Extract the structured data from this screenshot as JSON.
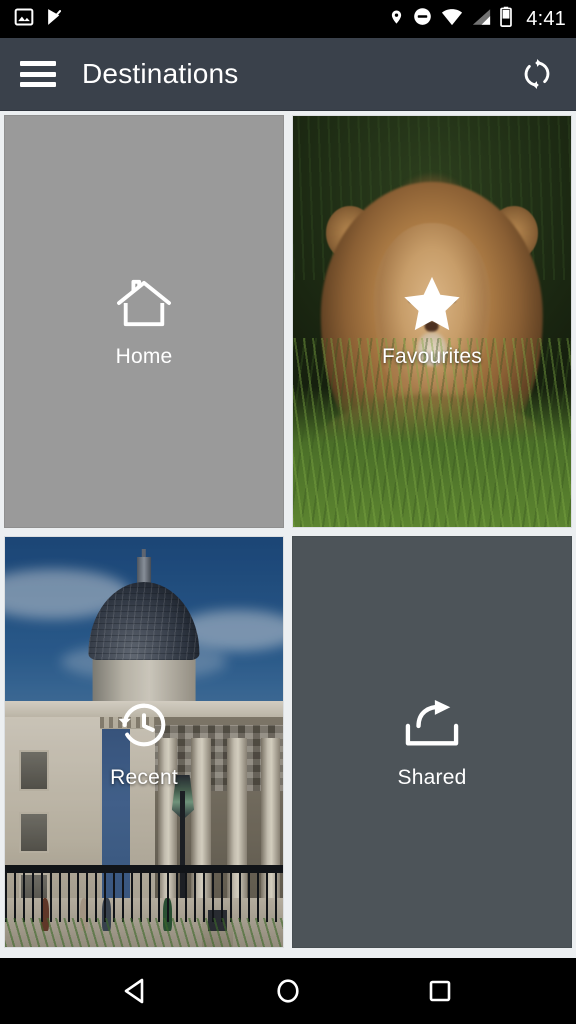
{
  "status_bar": {
    "left_icons": [
      {
        "name": "image-icon",
        "label": "Image"
      },
      {
        "name": "checkmark-flag-icon",
        "label": "Check"
      }
    ],
    "right_icons": [
      {
        "name": "location-pin-icon",
        "label": "Location"
      },
      {
        "name": "do-not-disturb-icon",
        "label": "Do not disturb"
      },
      {
        "name": "wifi-icon",
        "label": "Wi-Fi"
      },
      {
        "name": "cell-signal-icon",
        "label": "Signal"
      },
      {
        "name": "battery-icon",
        "label": "Battery"
      }
    ],
    "time": "4:41",
    "background": "#000000"
  },
  "app_bar": {
    "menu_icon": "hamburger-menu-icon",
    "title": "Destinations",
    "action_icon": "refresh-sync-icon",
    "background": "#3a414b",
    "text_color": "#ffffff"
  },
  "grid": {
    "tiles": [
      {
        "id": "home",
        "label": "Home",
        "icon": "home-icon",
        "kind": "solid",
        "background": "#9a9a9a"
      },
      {
        "id": "favourites",
        "label": "Favourites",
        "icon": "star-icon",
        "kind": "photo",
        "photo": "lion-in-grass"
      },
      {
        "id": "recent",
        "label": "Recent",
        "icon": "history-clock-icon",
        "kind": "photo",
        "photo": "national-gallery-building"
      },
      {
        "id": "shared",
        "label": "Shared",
        "icon": "share-export-icon",
        "kind": "solid",
        "background": "#4d5459"
      }
    ],
    "gap_color": "#eceff1"
  },
  "nav_bar": {
    "buttons": [
      {
        "name": "back-button",
        "icon": "triangle-left-icon",
        "label": "Back"
      },
      {
        "name": "home-button",
        "icon": "circle-icon",
        "label": "Home"
      },
      {
        "name": "recents-button",
        "icon": "square-icon",
        "label": "Recents"
      }
    ],
    "background": "#000000"
  }
}
